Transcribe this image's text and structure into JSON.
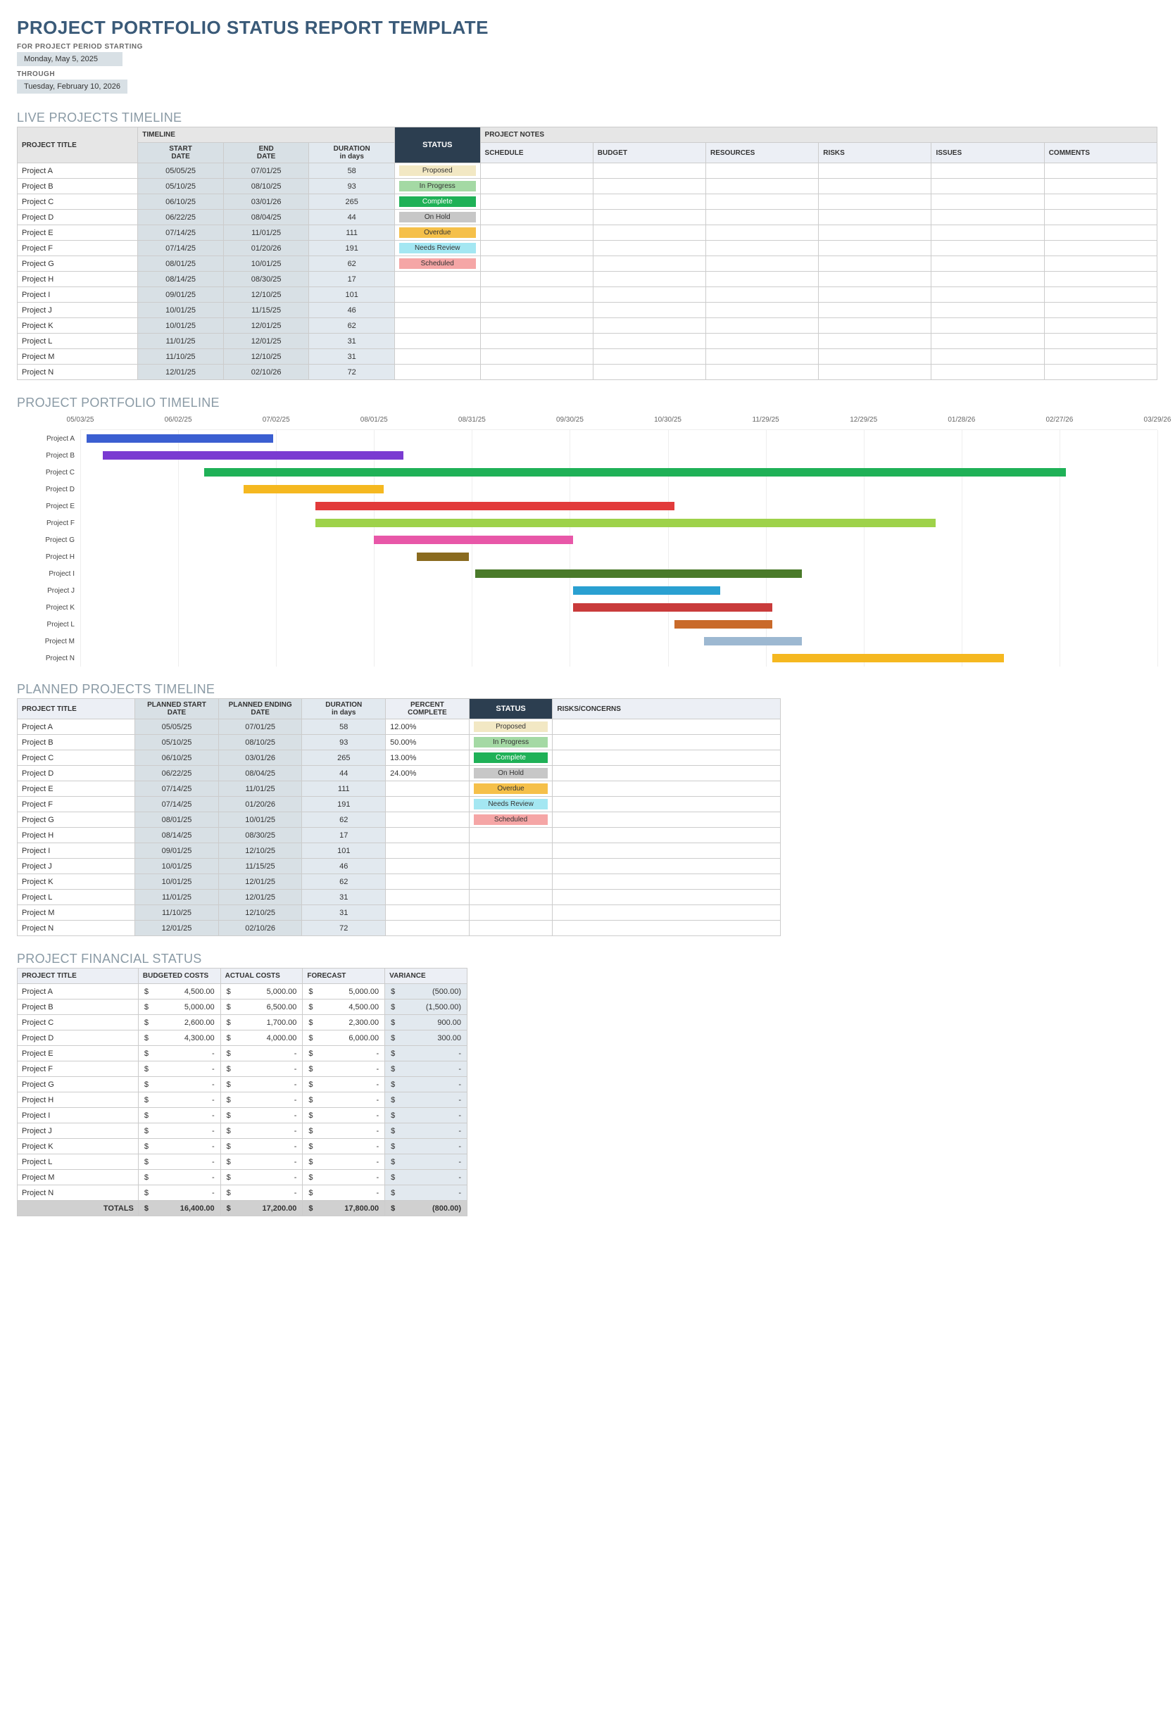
{
  "title": "PROJECT PORTFOLIO STATUS REPORT TEMPLATE",
  "period": {
    "start_label": "FOR PROJECT PERIOD STARTING",
    "start_value": "Monday, May 5, 2025",
    "through_label": "THROUGH",
    "end_value": "Tuesday, February 10, 2026"
  },
  "sections": {
    "live": "LIVE PROJECTS TIMELINE",
    "gantt": "PROJECT PORTFOLIO TIMELINE",
    "planned": "PLANNED PROJECTS TIMELINE",
    "financial": "PROJECT FINANCIAL STATUS"
  },
  "live_headers": {
    "group_timeline": "TIMELINE",
    "group_notes": "PROJECT NOTES",
    "project_title": "PROJECT TITLE",
    "start": "START",
    "date": "DATE",
    "end": "END",
    "duration": "DURATION",
    "in_days": "in days",
    "status": "STATUS",
    "schedule": "SCHEDULE",
    "budget": "BUDGET",
    "resources": "RESOURCES",
    "risks": "RISKS",
    "issues": "ISSUES",
    "comments": "COMMENTS"
  },
  "status_labels": {
    "proposed": "Proposed",
    "inprogress": "In Progress",
    "complete": "Complete",
    "onhold": "On Hold",
    "overdue": "Overdue",
    "needsreview": "Needs Review",
    "scheduled": "Scheduled"
  },
  "projects": [
    {
      "name": "Project A",
      "start": "05/05/25",
      "end": "07/01/25",
      "dur": "58",
      "status": "proposed",
      "pct": "12.00%",
      "color": "#3b5fd1"
    },
    {
      "name": "Project B",
      "start": "05/10/25",
      "end": "08/10/25",
      "dur": "93",
      "status": "inprogress",
      "pct": "50.00%",
      "color": "#7a3bd1"
    },
    {
      "name": "Project C",
      "start": "06/10/25",
      "end": "03/01/26",
      "dur": "265",
      "status": "complete",
      "pct": "13.00%",
      "color": "#1fb157"
    },
    {
      "name": "Project D",
      "start": "06/22/25",
      "end": "08/04/25",
      "dur": "44",
      "status": "onhold",
      "pct": "24.00%",
      "color": "#f5b820"
    },
    {
      "name": "Project E",
      "start": "07/14/25",
      "end": "11/01/25",
      "dur": "111",
      "status": "overdue",
      "pct": "",
      "color": "#e23b3b"
    },
    {
      "name": "Project F",
      "start": "07/14/25",
      "end": "01/20/26",
      "dur": "191",
      "status": "needsreview",
      "pct": "",
      "color": "#9ed24a"
    },
    {
      "name": "Project G",
      "start": "08/01/25",
      "end": "10/01/25",
      "dur": "62",
      "status": "scheduled",
      "pct": "",
      "color": "#e857a8"
    },
    {
      "name": "Project H",
      "start": "08/14/25",
      "end": "08/30/25",
      "dur": "17",
      "status": "",
      "pct": "",
      "color": "#8a6b1f"
    },
    {
      "name": "Project I",
      "start": "09/01/25",
      "end": "12/10/25",
      "dur": "101",
      "status": "",
      "pct": "",
      "color": "#4a7a2a"
    },
    {
      "name": "Project J",
      "start": "10/01/25",
      "end": "11/15/25",
      "dur": "46",
      "status": "",
      "pct": "",
      "color": "#2aa0d1"
    },
    {
      "name": "Project K",
      "start": "10/01/25",
      "end": "12/01/25",
      "dur": "62",
      "status": "",
      "pct": "",
      "color": "#c93b3b"
    },
    {
      "name": "Project L",
      "start": "11/01/25",
      "end": "12/01/25",
      "dur": "31",
      "status": "",
      "pct": "",
      "color": "#c96a2a"
    },
    {
      "name": "Project M",
      "start": "11/10/25",
      "end": "12/10/25",
      "dur": "31",
      "status": "",
      "pct": "",
      "color": "#9db8d1"
    },
    {
      "name": "Project N",
      "start": "12/01/25",
      "end": "02/10/26",
      "dur": "72",
      "status": "",
      "pct": "",
      "color": "#f5b820"
    }
  ],
  "gantt": {
    "start": "05/03/25",
    "end": "03/29/26",
    "total_days": 330,
    "ticks": [
      "05/03/25",
      "06/02/25",
      "07/02/25",
      "08/01/25",
      "08/31/25",
      "09/30/25",
      "10/30/25",
      "11/29/25",
      "12/29/25",
      "01/28/26",
      "02/27/26",
      "03/29/26"
    ],
    "tick_days": [
      0,
      30,
      60,
      90,
      120,
      150,
      180,
      210,
      240,
      270,
      300,
      330
    ]
  },
  "planned_headers": {
    "project_title": "PROJECT TITLE",
    "planned_start": "PLANNED START DATE",
    "planned_end": "PLANNED ENDING",
    "date": "DATE",
    "duration": "DURATION",
    "in_days": "in days",
    "pct": "PERCENT COMPLETE",
    "status": "STATUS",
    "risks": "RISKS/CONCERNS"
  },
  "fin_headers": {
    "project_title": "PROJECT TITLE",
    "budgeted": "BUDGETED COSTS",
    "actual": "ACTUAL COSTS",
    "forecast": "FORECAST",
    "variance": "VARIANCE",
    "totals": "TOTALS"
  },
  "financials": [
    {
      "name": "Project A",
      "b": "4,500.00",
      "a": "5,000.00",
      "f": "5,000.00",
      "v": "(500.00)"
    },
    {
      "name": "Project B",
      "b": "5,000.00",
      "a": "6,500.00",
      "f": "4,500.00",
      "v": "(1,500.00)"
    },
    {
      "name": "Project C",
      "b": "2,600.00",
      "a": "1,700.00",
      "f": "2,300.00",
      "v": "900.00"
    },
    {
      "name": "Project D",
      "b": "4,300.00",
      "a": "4,000.00",
      "f": "6,000.00",
      "v": "300.00"
    },
    {
      "name": "Project E",
      "b": "-",
      "a": "-",
      "f": "-",
      "v": "-"
    },
    {
      "name": "Project F",
      "b": "-",
      "a": "-",
      "f": "-",
      "v": "-"
    },
    {
      "name": "Project G",
      "b": "-",
      "a": "-",
      "f": "-",
      "v": "-"
    },
    {
      "name": "Project H",
      "b": "-",
      "a": "-",
      "f": "-",
      "v": "-"
    },
    {
      "name": "Project I",
      "b": "-",
      "a": "-",
      "f": "-",
      "v": "-"
    },
    {
      "name": "Project J",
      "b": "-",
      "a": "-",
      "f": "-",
      "v": "-"
    },
    {
      "name": "Project K",
      "b": "-",
      "a": "-",
      "f": "-",
      "v": "-"
    },
    {
      "name": "Project L",
      "b": "-",
      "a": "-",
      "f": "-",
      "v": "-"
    },
    {
      "name": "Project M",
      "b": "-",
      "a": "-",
      "f": "-",
      "v": "-"
    },
    {
      "name": "Project N",
      "b": "-",
      "a": "-",
      "f": "-",
      "v": "-"
    }
  ],
  "fin_totals": {
    "b": "16,400.00",
    "a": "17,200.00",
    "f": "17,800.00",
    "v": "(800.00)"
  },
  "currency": "$",
  "chart_data": {
    "type": "gantt",
    "title": "PROJECT PORTFOLIO TIMELINE",
    "x_start": "2025-05-03",
    "x_end": "2026-03-29",
    "x_ticks": [
      "05/03/25",
      "06/02/25",
      "07/02/25",
      "08/01/25",
      "08/31/25",
      "09/30/25",
      "10/30/25",
      "11/29/25",
      "12/29/25",
      "01/28/26",
      "02/27/26",
      "03/29/26"
    ],
    "series": [
      {
        "name": "Project A",
        "start": "2025-05-05",
        "end": "2025-07-01",
        "status": "Proposed",
        "color": "#3b5fd1"
      },
      {
        "name": "Project B",
        "start": "2025-05-10",
        "end": "2025-08-10",
        "status": "In Progress",
        "color": "#7a3bd1"
      },
      {
        "name": "Project C",
        "start": "2025-06-10",
        "end": "2026-03-01",
        "status": "Complete",
        "color": "#1fb157"
      },
      {
        "name": "Project D",
        "start": "2025-06-22",
        "end": "2025-08-04",
        "status": "On Hold",
        "color": "#f5b820"
      },
      {
        "name": "Project E",
        "start": "2025-07-14",
        "end": "2025-11-01",
        "status": "Overdue",
        "color": "#e23b3b"
      },
      {
        "name": "Project F",
        "start": "2025-07-14",
        "end": "2026-01-20",
        "status": "Needs Review",
        "color": "#9ed24a"
      },
      {
        "name": "Project G",
        "start": "2025-08-01",
        "end": "2025-10-01",
        "status": "Scheduled",
        "color": "#e857a8"
      },
      {
        "name": "Project H",
        "start": "2025-08-14",
        "end": "2025-08-30",
        "status": "",
        "color": "#8a6b1f"
      },
      {
        "name": "Project I",
        "start": "2025-09-01",
        "end": "2025-12-10",
        "status": "",
        "color": "#4a7a2a"
      },
      {
        "name": "Project J",
        "start": "2025-10-01",
        "end": "2025-11-15",
        "status": "",
        "color": "#2aa0d1"
      },
      {
        "name": "Project K",
        "start": "2025-10-01",
        "end": "2025-12-01",
        "status": "",
        "color": "#c93b3b"
      },
      {
        "name": "Project L",
        "start": "2025-11-01",
        "end": "2025-12-01",
        "status": "",
        "color": "#c96a2a"
      },
      {
        "name": "Project M",
        "start": "2025-11-10",
        "end": "2025-12-10",
        "status": "",
        "color": "#9db8d1"
      },
      {
        "name": "Project N",
        "start": "2025-12-01",
        "end": "2026-02-10",
        "status": "",
        "color": "#f5b820"
      }
    ]
  }
}
